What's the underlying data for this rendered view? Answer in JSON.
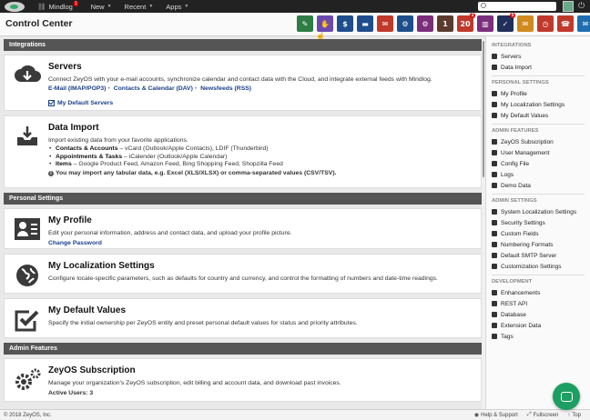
{
  "topbar": {
    "user": "Mindlog",
    "user_badge": "1",
    "menu": [
      "New",
      "Recent",
      "Apps"
    ]
  },
  "header": {
    "title": "Control Center",
    "apps": [
      {
        "name": "notes",
        "color": "#2e7d45",
        "glyph": "✎",
        "badge": ""
      },
      {
        "name": "handshake",
        "color": "#6a4ab0",
        "glyph": "✋",
        "badge": ""
      },
      {
        "name": "dollar",
        "color": "#1f4e8c",
        "glyph": "$",
        "badge": ""
      },
      {
        "name": "truck",
        "color": "#1f4e8c",
        "glyph": "▬",
        "badge": ""
      },
      {
        "name": "mail-out",
        "color": "#c0392b",
        "glyph": "✉",
        "badge": ""
      },
      {
        "name": "gear-app",
        "color": "#1f4e8c",
        "glyph": "⚙",
        "badge": ""
      },
      {
        "name": "gear-app-2",
        "color": "#7b2e7b",
        "glyph": "⚙",
        "badge": ""
      },
      {
        "name": "ledger",
        "color": "#5a3b2e",
        "glyph": "1",
        "badge": ""
      },
      {
        "name": "calendar",
        "color": "#c0392b",
        "glyph": "20",
        "badge": "2"
      },
      {
        "name": "inbox",
        "color": "#7b2e7b",
        "glyph": "▥",
        "badge": ""
      },
      {
        "name": "tasks",
        "color": "#1f2f5a",
        "glyph": "✓",
        "badge": "5"
      },
      {
        "name": "envelope-open",
        "color": "#d08a20",
        "glyph": "✉",
        "badge": ""
      },
      {
        "name": "timer",
        "color": "#c0392b",
        "glyph": "◷",
        "badge": ""
      },
      {
        "name": "phone",
        "color": "#c0392b",
        "glyph": "☎",
        "badge": ""
      },
      {
        "name": "mail",
        "color": "#1f6fb0",
        "glyph": "✉",
        "badge": "1"
      }
    ]
  },
  "sections": {
    "integrations": "Integrations",
    "personal": "Personal Settings",
    "admin": "Admin Features"
  },
  "servers": {
    "title": "Servers",
    "desc": "Connect ZeyOS with your e-mail accounts, synchronize calendar and contact data with the Cloud, and integrate external feeds with Mindlog.",
    "links": [
      "E-Mail (IMAP/POP3)",
      "Contacts & Calendar (DAV)",
      "Newsfeeds (RSS)"
    ],
    "default_link": "My Default Servers"
  },
  "data_import": {
    "title": "Data Import",
    "desc": "Import existing data from your favorite applications.",
    "items": [
      {
        "label": "Contacts & Accounts",
        "rest": " – vCard (Outlook/Apple Contacts), LDIF (Thunderbird)"
      },
      {
        "label": "Appointments & Tasks",
        "rest": " – iCalender (Outlook/Apple Calendar)"
      },
      {
        "label": "Items",
        "rest": " – Google Product Feed, Amazon Feed, Bing Shopping Feed, Shopzilla Feed"
      }
    ],
    "note": "You may import any tabular data, e.g. Excel (XLS/XLSX) or comma-separated values (CSV/TSV)."
  },
  "my_profile": {
    "title": "My Profile",
    "desc": "Edit your personal information, address and contact data, and upload your profile picture.",
    "link": "Change Password"
  },
  "localization": {
    "title": "My Localization Settings",
    "desc": "Configure locale-specific parameters, such as defaults for country and currency, and control the formatting of numbers and date-time readings."
  },
  "default_values": {
    "title": "My Default Values",
    "desc": "Specify the initial ownership per ZeyOS entity and preset personal default values for status and priority attributes."
  },
  "subscription": {
    "title": "ZeyOS Subscription",
    "desc": "Manage your organization's ZeyOS subscription, edit billing and account data, and download past invoices.",
    "active_users": "Active Users: 3"
  },
  "sidebar": {
    "groups": [
      {
        "title": "Integrations",
        "items": [
          "Servers",
          "Data Import"
        ]
      },
      {
        "title": "Personal Settings",
        "items": [
          "My Profile",
          "My Localization Settings",
          "My Default Values"
        ]
      },
      {
        "title": "Admin Features",
        "items": [
          "ZeyOS Subscription",
          "User Management",
          "Config File",
          "Logs",
          "Demo Data"
        ]
      },
      {
        "title": "Admin Settings",
        "items": [
          "System Localization Settings",
          "Security Settings",
          "Custom Fields",
          "Numbering Formats",
          "Default SMTP Server",
          "Customization Settings"
        ]
      },
      {
        "title": "Development",
        "items": [
          "Enhancements",
          "REST API",
          "Database",
          "Extension Data",
          "Tags"
        ]
      }
    ]
  },
  "footer": {
    "copyright": "© 2018 ZeyOS, Inc.",
    "help": "Help & Support",
    "fullscreen": "Fullscreen",
    "top": "Top"
  }
}
